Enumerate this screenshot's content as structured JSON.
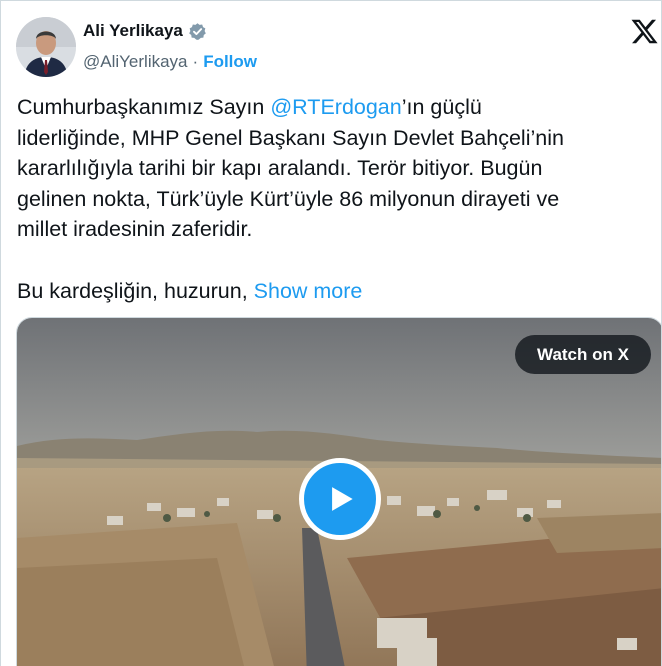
{
  "author": {
    "display_name": "Ali Yerlikaya",
    "handle": "@AliYerlikaya",
    "separator": "·",
    "follow_label": "Follow",
    "verified": true
  },
  "tweet": {
    "lines": [
      {
        "before": "Cumhurbaşkanımız Sayın ",
        "mention": "@RTErdogan",
        "after": "’ın güçlü"
      },
      {
        "text": "liderliğinde, MHP Genel Başkanı Sayın Devlet Bahçeli’nin"
      },
      {
        "text": "kararlılığıyla tarihi bir kapı aralandı. Terör bitiyor. Bugün"
      },
      {
        "text": "gelinen nokta, Türk’üyle Kürt’üyle 86 milyonun dirayeti ve"
      },
      {
        "text": "millet iradesinin zaferidir."
      }
    ],
    "last_line": "Bu kardeşliğin, huzurun, ",
    "show_more": "Show more"
  },
  "media": {
    "watch_label": "Watch on X",
    "play_icon": "play-icon"
  },
  "colors": {
    "link": "#1d9bf0",
    "text": "#0f1419",
    "secondary": "#536471",
    "border": "#cfd9de"
  }
}
